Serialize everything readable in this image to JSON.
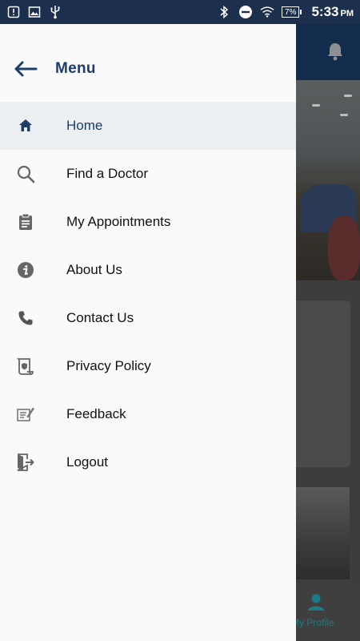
{
  "status_bar": {
    "time": "5:33",
    "ampm": "PM",
    "battery": "7%",
    "left_icons": [
      "alert-icon",
      "image-icon",
      "usb-icon"
    ],
    "right_icons": [
      "bluetooth-icon",
      "dnd-icon",
      "wifi-icon",
      "battery-icon"
    ]
  },
  "drawer": {
    "title": "Menu",
    "back_icon": "arrow-left-icon",
    "accent_color": "#1d3d6b",
    "items": [
      {
        "label": "Home",
        "icon": "home-icon",
        "active": true
      },
      {
        "label": "Find a Doctor",
        "icon": "search-icon",
        "active": false
      },
      {
        "label": "My Appointments",
        "icon": "clipboard-icon",
        "active": false
      },
      {
        "label": "About Us",
        "icon": "info-icon",
        "active": false
      },
      {
        "label": "Contact Us",
        "icon": "phone-icon",
        "active": false
      },
      {
        "label": "Privacy Policy",
        "icon": "scroll-shield-icon",
        "active": false
      },
      {
        "label": "Feedback",
        "icon": "feedback-icon",
        "active": false
      },
      {
        "label": "Logout",
        "icon": "logout-icon",
        "active": false
      }
    ]
  },
  "background_app": {
    "bottom_nav_label": "My Profile",
    "header_icon": "bell-icon"
  }
}
